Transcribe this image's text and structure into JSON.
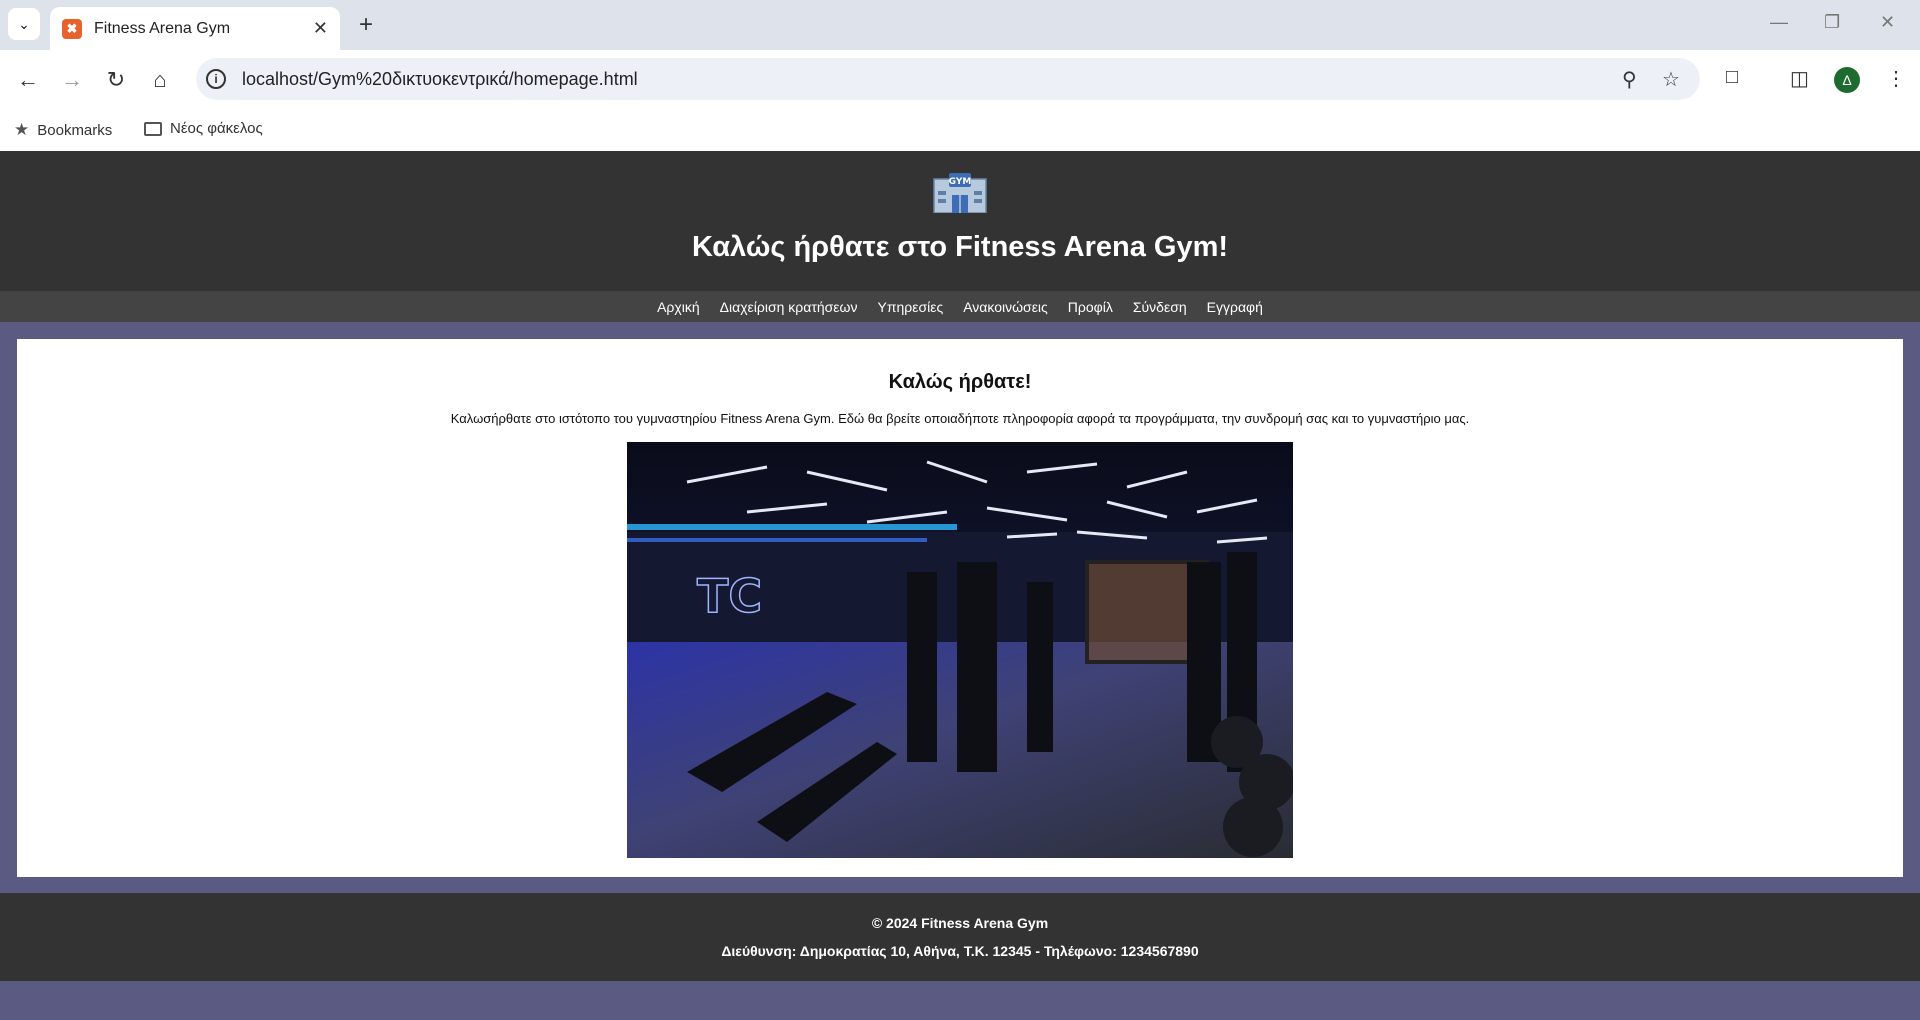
{
  "browser": {
    "tab_title": "Fitness Arena Gym",
    "url": "localhost/Gym%20δικτυοκεντρικά/homepage.html",
    "bookmarks": [
      {
        "label": "Bookmarks",
        "icon": "star-icon"
      },
      {
        "label": "Νέος φάκελος",
        "icon": "folder-icon"
      }
    ],
    "profile_initial": "Δ"
  },
  "header": {
    "logo_text": "GYM",
    "title": "Καλώς ήρθατε στο Fitness Arena Gym!"
  },
  "nav": {
    "items": [
      "Αρχική",
      "Διαχείριση κρατήσεων",
      "Υπηρεσίες",
      "Ανακοινώσεις",
      "Προφίλ",
      "Σύνδεση",
      "Εγγραφή"
    ]
  },
  "main": {
    "heading": "Καλώς ήρθατε!",
    "intro": "Καλωσήρθατε στο ιστότοπο του γυμναστηρίου Fitness Arena Gym. Εδώ θα βρείτε οποιαδήποτε πληροφορία αφορά τα προγράμματα, την συνδρομή σας και το γυμναστήριο μας."
  },
  "footer": {
    "copyright": "© 2024 Fitness Arena Gym",
    "contact": "Διεύθυνση: Δημοκρατίας 10, Αθήνα, Τ.Κ. 12345 - Τηλέφωνο: 1234567890"
  },
  "colors": {
    "page_bg": "#5a5a82",
    "header_bg": "#333333",
    "nav_bg": "#444444"
  }
}
